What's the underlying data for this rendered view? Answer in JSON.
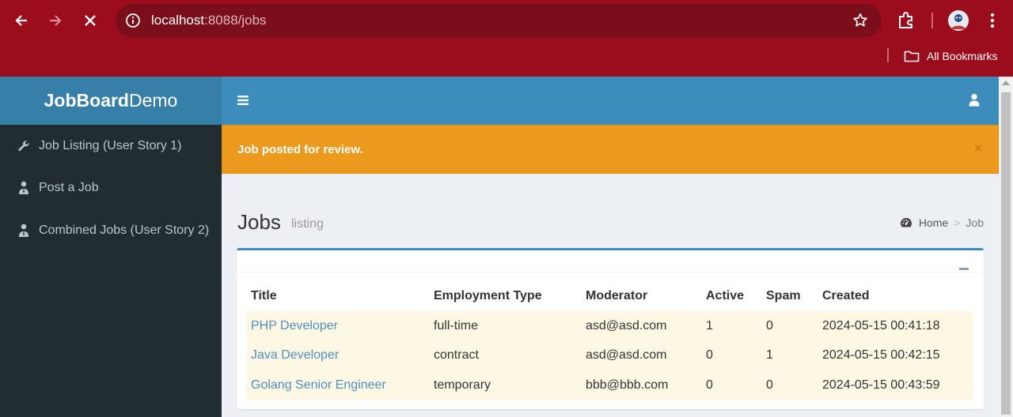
{
  "browser": {
    "url_host": "localhost",
    "url_rest": ":8088/jobs",
    "bookmarks_label": "All Bookmarks"
  },
  "app": {
    "logo_bold": "JobBoard",
    "logo_light": "Demo"
  },
  "sidebar": {
    "items": [
      {
        "label": "Job Listing (User Story 1)",
        "icon": "wrench-icon"
      },
      {
        "label": "Post a Job",
        "icon": "user-tie-icon"
      },
      {
        "label": "Combined Jobs (User Story 2)",
        "icon": "user-tie-icon"
      }
    ]
  },
  "alert": {
    "message": "Job posted for review.",
    "close": "×"
  },
  "header": {
    "title": "Jobs",
    "subtitle": "listing",
    "breadcrumb": [
      "Home",
      ">",
      "Job"
    ]
  },
  "table": {
    "headers": [
      "Title",
      "Employment Type",
      "Moderator",
      "Active",
      "Spam",
      "Created"
    ],
    "rows": [
      [
        "PHP Developer",
        "full-time",
        "asd@asd.com",
        "1",
        "0",
        "2024-05-15 00:41:18"
      ],
      [
        "Java Developer",
        "contract",
        "asd@asd.com",
        "0",
        "1",
        "2024-05-15 00:42:15"
      ],
      [
        "Golang Senior Engineer",
        "temporary",
        "bbb@bbb.com",
        "0",
        "0",
        "2024-05-15 00:43:59"
      ]
    ]
  },
  "colors": {
    "chrome": "#9b0c1c",
    "omnibox": "#7a0f1b",
    "logo_bg": "#367fa9",
    "navbar": "#3c8dbc",
    "sidebar": "#222d32",
    "alert": "#ec9a1d",
    "row_highlight": "#fcf8e3",
    "link": "#4f8fc1"
  }
}
